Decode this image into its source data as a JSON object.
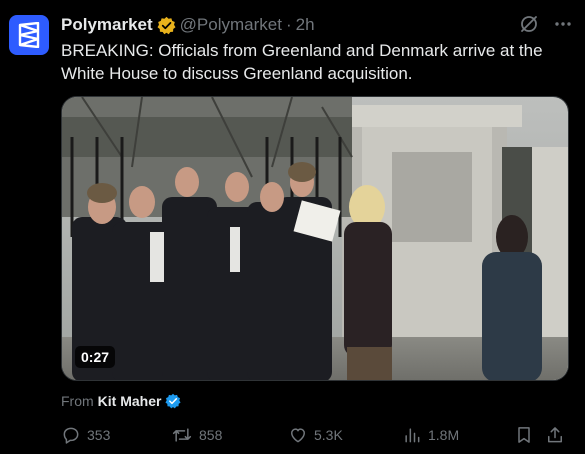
{
  "tweet": {
    "display_name": "Polymarket",
    "handle": "@Polymarket",
    "separator": "·",
    "time": "2h",
    "text": "BREAKING: Officials from Greenland and Denmark arrive at the White House to discuss Greenland acquisition.",
    "icons": {
      "avatar": "polymarket-logo",
      "verified": "gold-verified-badge",
      "grok": "grok-icon",
      "more": "more-icon"
    }
  },
  "media": {
    "duration": "0:27"
  },
  "attribution": {
    "from": "From",
    "author": "Kit Maher",
    "verified": "blue-verified-badge"
  },
  "actions": {
    "replies": "353",
    "reposts": "858",
    "likes": "5.3K",
    "views": "1.8M",
    "icons": [
      "reply-icon",
      "repost-icon",
      "like-icon",
      "views-icon",
      "bookmark-icon",
      "share-icon"
    ]
  },
  "colors": {
    "background": "#000000",
    "text_primary": "#e7e9ea",
    "text_secondary": "#71767b",
    "brand_blue": "#2e5cff",
    "gold_badge": "#e8b21c",
    "blue_badge": "#1d9bf0"
  }
}
